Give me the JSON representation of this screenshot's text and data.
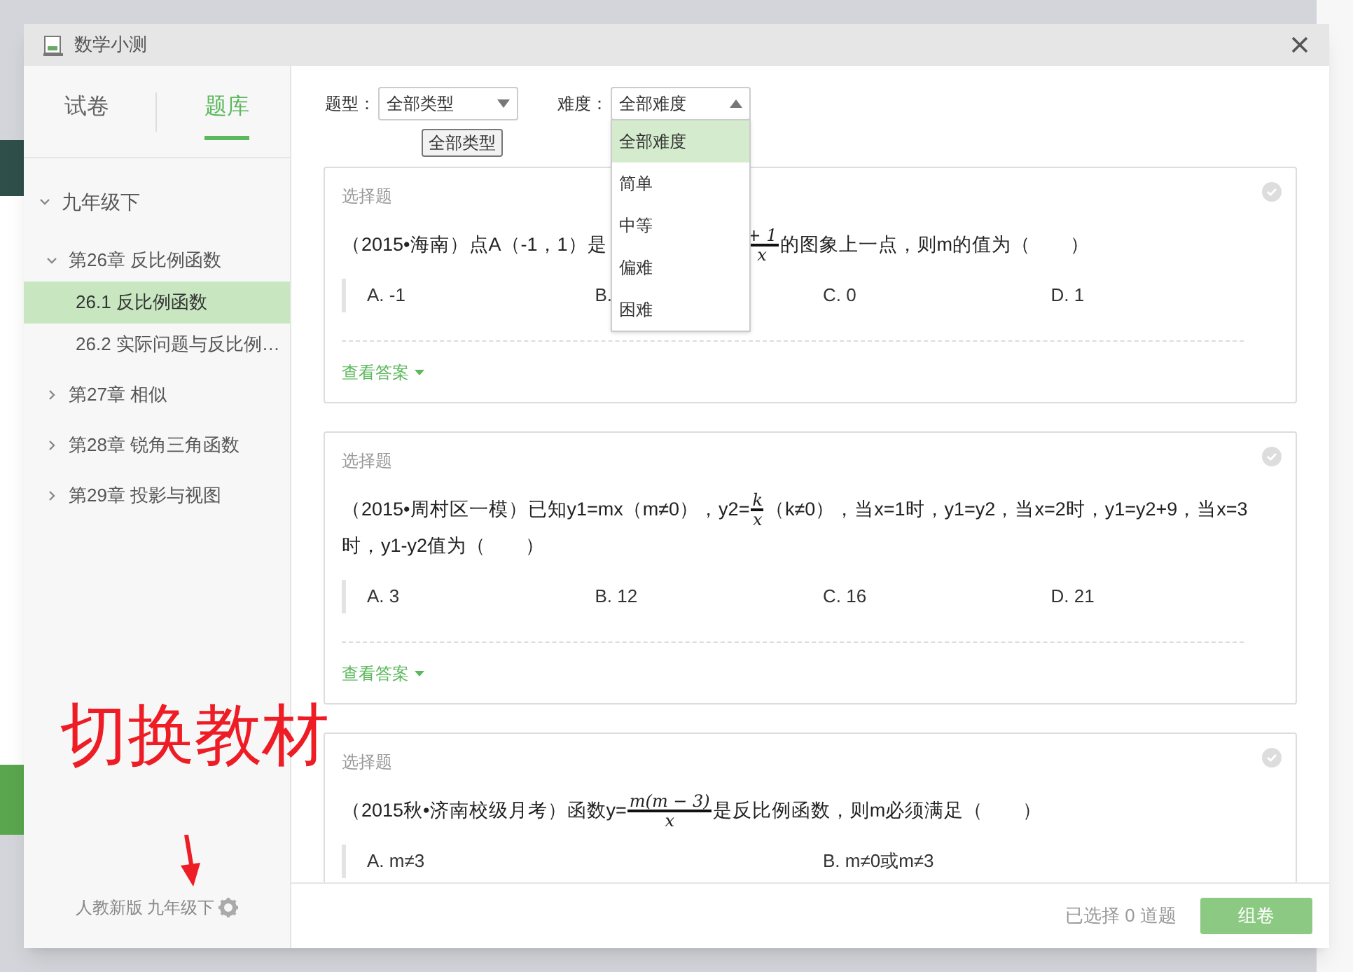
{
  "window": {
    "title": "数学小测"
  },
  "sidebar": {
    "tabs": [
      {
        "label": "试卷",
        "selected": false
      },
      {
        "label": "题库",
        "selected": true
      }
    ],
    "tree": [
      {
        "label": "九年级下",
        "expanded": true,
        "selected": false,
        "children": [
          {
            "label": "第26章 反比例函数",
            "expanded": true,
            "selected": false,
            "children": [
              {
                "label": "26.1 反比例函数",
                "selected": true
              },
              {
                "label": "26.2 实际问题与反比例…",
                "selected": false
              }
            ]
          },
          {
            "label": "第27章 相似",
            "expanded": false,
            "selected": false
          },
          {
            "label": "第28章 锐角三角函数",
            "expanded": false,
            "selected": false
          },
          {
            "label": "第29章 投影与视图",
            "expanded": false,
            "selected": false
          }
        ]
      }
    ],
    "textbook": "人教新版 九年级下"
  },
  "filters": [
    {
      "label": "题型：",
      "value": "全部类型",
      "open": false
    },
    {
      "label": "难度：",
      "value": "全部难度",
      "open": true
    }
  ],
  "tooltip": "全部类型",
  "dropdown": {
    "options": [
      {
        "label": "全部难度",
        "selected": true
      },
      {
        "label": "简单",
        "selected": false
      },
      {
        "label": "中等",
        "selected": false
      },
      {
        "label": "偏难",
        "selected": false
      },
      {
        "label": "困难",
        "selected": false
      }
    ]
  },
  "questions": [
    {
      "type": "选择题",
      "stem": [
        {
          "kind": "text",
          "text": "（2015•海南）点A（-1，1）是"
        },
        {
          "kind": "covered"
        },
        {
          "kind": "fraction",
          "numerator": "+ 1",
          "denominator": "x"
        },
        {
          "kind": "text",
          "text": "的图象上一点，则m的值为（　　）"
        }
      ],
      "options": [
        "A. -1",
        "B.",
        "C. 0",
        "D. 1"
      ],
      "wide_options": false,
      "answer_link": "查看答案"
    },
    {
      "type": "选择题",
      "stem": [
        {
          "kind": "text",
          "text": "（2015•周村区一模）已知y1=mx（m≠0），y2="
        },
        {
          "kind": "fraction",
          "numerator": "k",
          "denominator": "x"
        },
        {
          "kind": "text",
          "text": "（k≠0），当x=1时，y1=y2，当x=2时，y1=y2+9，当x=3时，y1-y2值为（　　）"
        }
      ],
      "options": [
        "A. 3",
        "B. 12",
        "C. 16",
        "D. 21"
      ],
      "wide_options": false,
      "answer_link": "查看答案"
    },
    {
      "type": "选择题",
      "stem": [
        {
          "kind": "text",
          "text": "（2015秋•济南校级月考）函数y="
        },
        {
          "kind": "fraction",
          "numerator": "m(m − 3)",
          "denominator": "x"
        },
        {
          "kind": "text",
          "text": "是反比例函数，则m必须满足（　　）"
        }
      ],
      "options": [
        "A. m≠3",
        "B. m≠0或m≠3"
      ],
      "wide_options": true
    }
  ],
  "footer": {
    "selected_count": "已选择 0 道题",
    "button": {
      "label": "组卷",
      "disabled": true
    }
  },
  "annotation": {
    "text": "切换教材"
  }
}
